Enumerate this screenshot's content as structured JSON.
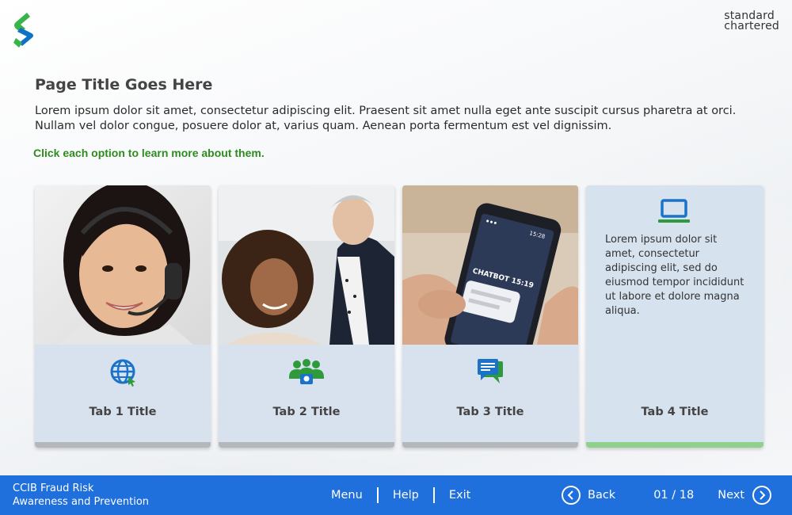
{
  "header": {
    "brand_line1": "standard",
    "brand_line2": "chartered"
  },
  "page": {
    "title": "Page Title Goes Here",
    "intro_line1": "Lorem ipsum dolor sit amet, consectetur adipiscing elit. Praesent sit amet nulla eget ante suscipit cursus pharetra at orci.",
    "intro_line2": "Nullam vel dolor congue, posuere dolor at, varius quam. Aenean porta fermentum est vel dignissim.",
    "instruction": "Click each option to learn more about them."
  },
  "tabs": [
    {
      "title": "Tab 1 Title",
      "icon": "globe-icon"
    },
    {
      "title": "Tab 2 Title",
      "icon": "team-icon"
    },
    {
      "title": "Tab 3 Title",
      "icon": "chat-icon",
      "phone_text": "CHATBOT 15:19",
      "phone_time": "15:28"
    },
    {
      "title": "Tab 4 Title",
      "icon": "laptop-icon",
      "description": "Lorem ipsum dolor sit amet, consectetur adipiscing elit, sed do eiusmod tempor incididunt ut labore et dolore magna aliqua.",
      "selected": true
    }
  ],
  "footer": {
    "course_line1": "CCIB Fraud Risk",
    "course_line2": "Awareness and Prevention",
    "menu": "Menu",
    "help": "Help",
    "exit": "Exit",
    "back": "Back",
    "page_count": "01 / 18",
    "next": "Next"
  },
  "colors": {
    "footer": "#1f6fdc",
    "instruction_green": "#2e8b1e",
    "active_bar": "#8dd18d",
    "icon_blue": "#1a73c9",
    "icon_green": "#2e9a3c"
  }
}
